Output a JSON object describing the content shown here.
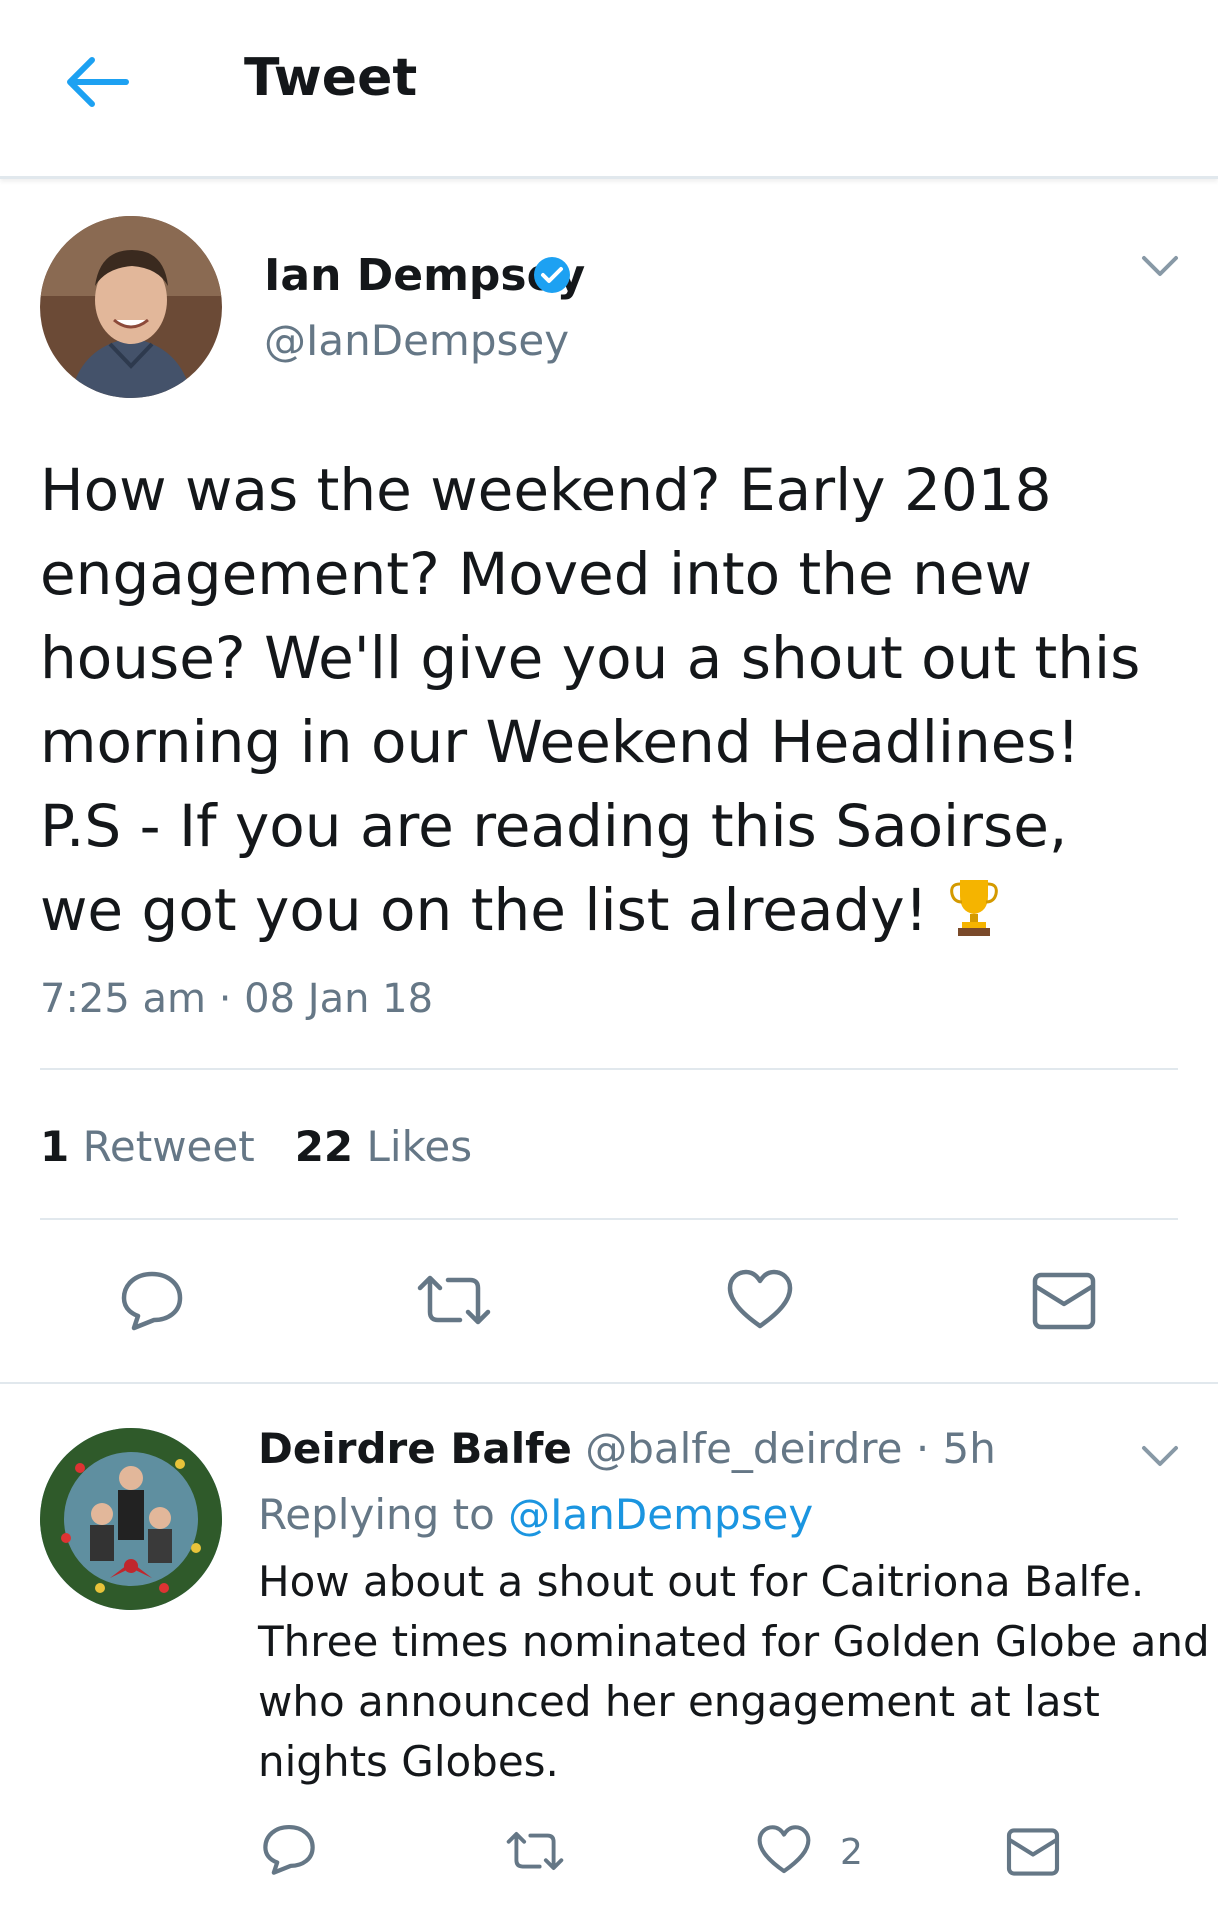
{
  "header": {
    "title": "Tweet",
    "back_icon": "back-arrow-icon",
    "accent": "#1da1f2"
  },
  "tweet": {
    "author": {
      "name": "Ian Dempsey",
      "handle": "@IanDempsey",
      "verified": true
    },
    "lines": [
      "How was the weekend? Early 2018",
      "engagement? Moved into the new",
      "house? We'll give you a shout out this",
      "morning in our Weekend Headlines!",
      "P.S - If you are reading this Saoirse,",
      "we got you on the list already!"
    ],
    "emoji": "trophy-icon",
    "timestamp": "7:25 am · 08 Jan 18",
    "retweet_count": "1",
    "retweet_label": "Retweet",
    "like_count": "22",
    "like_label": "Likes"
  },
  "reply": {
    "name": "Deirdre Balfe",
    "handle": "@balfe_deirdre",
    "time": "5h",
    "replying_label": "Replying to",
    "replying_handle": "@IanDempsey",
    "lines": [
      "How about a shout out for Caitriona Balfe.",
      "Three times nominated for Golden Globe and",
      "who announced her engagement at last",
      "nights Globes."
    ],
    "like_count": "2"
  },
  "colors": {
    "text": "#14171a",
    "muted": "#657786",
    "link": "#1b95e0",
    "divider": "#e1e8ed",
    "icon": "#657786"
  }
}
